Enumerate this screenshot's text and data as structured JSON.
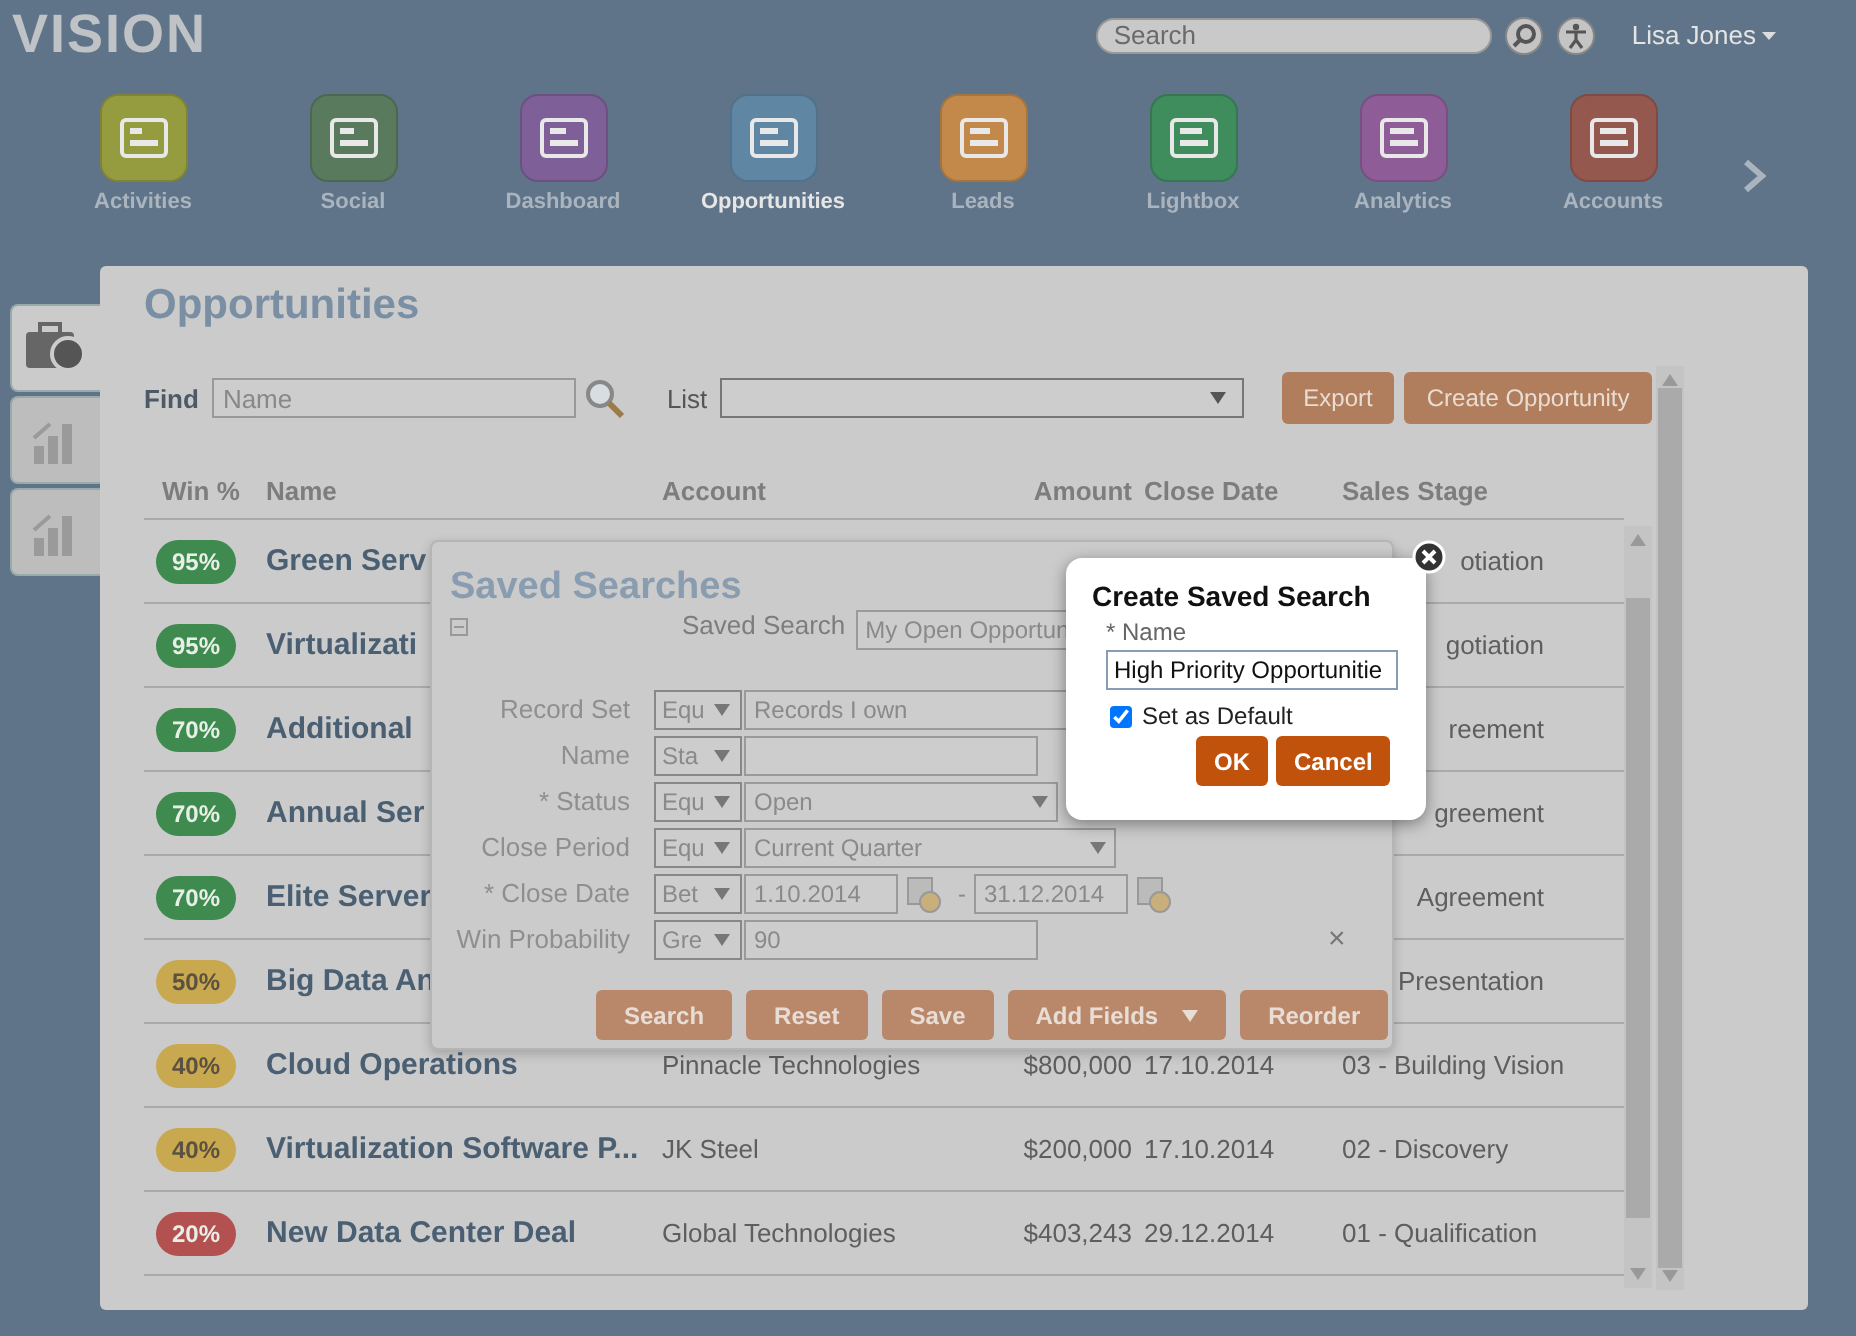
{
  "header": {
    "logo": "VISION",
    "search": {
      "placeholder": "Search"
    },
    "user": "Lisa Jones"
  },
  "nav": [
    {
      "label": "Activities",
      "color": "#959b3f",
      "selected": false
    },
    {
      "label": "Social",
      "color": "#5a7a5e",
      "selected": false
    },
    {
      "label": "Dashboard",
      "color": "#7e5f98",
      "selected": false
    },
    {
      "label": "Opportunities",
      "color": "#5f86a3",
      "selected": true
    },
    {
      "label": "Leads",
      "color": "#c2894a",
      "selected": false
    },
    {
      "label": "Lightbox",
      "color": "#3f8c5c",
      "selected": false
    },
    {
      "label": "Analytics",
      "color": "#8e5d97",
      "selected": false
    },
    {
      "label": "Accounts",
      "color": "#95584f",
      "selected": false
    }
  ],
  "side_tabs": [
    {
      "selected": true
    },
    {
      "selected": false
    },
    {
      "selected": false
    }
  ],
  "page": {
    "title": "Opportunities",
    "find_label": "Find",
    "find_placeholder": "Name",
    "list_label": "List",
    "buttons": [
      "Export",
      "Create Opportunity"
    ]
  },
  "table": {
    "columns": [
      "Win %",
      "Name",
      "Account",
      "Amount",
      "Close Date",
      "Sales Stage"
    ],
    "rows": [
      {
        "win": "95%",
        "color": "#3f8a4e",
        "name": "Green Serv",
        "stage": "otiation"
      },
      {
        "win": "95%",
        "color": "#3f8a4e",
        "name": "Virtualizati",
        "stage": "gotiation"
      },
      {
        "win": "70%",
        "color": "#3f8a4e",
        "name": "Additional",
        "stage": "reement"
      },
      {
        "win": "70%",
        "color": "#3f8a4e",
        "name": "Annual Ser",
        "stage": "greement"
      },
      {
        "win": "70%",
        "color": "#3f8a4e",
        "name": "Elite Server",
        "stage": "Agreement"
      },
      {
        "win": "50%",
        "color": "#c9a94f",
        "name": "Big Data An",
        "stage": "Presentation"
      },
      {
        "win": "40%",
        "color": "#c9a94f",
        "name": "Cloud Operations",
        "account": "Pinnacle Technologies",
        "amount": "$800,000",
        "date": "17.10.2014",
        "stage": "03 - Building Vision"
      },
      {
        "win": "40%",
        "color": "#c9a94f",
        "name": "Virtualization Software P...",
        "account": "JK Steel",
        "amount": "$200,000",
        "date": "17.10.2014",
        "stage": "02 - Discovery"
      },
      {
        "win": "20%",
        "color": "#b2514f",
        "name": "New Data Center Deal",
        "account": "Global Technologies",
        "amount": "$403,243",
        "date": "29.12.2014",
        "stage": "01 - Qualification"
      }
    ]
  },
  "saved_searches": {
    "title": "Saved Searches",
    "saved_search_label": "Saved Search",
    "saved_search_value": "My Open Opportun",
    "fields": [
      {
        "kind": "text",
        "label": "Record Set",
        "operator": "Equ",
        "value": "Records I own"
      },
      {
        "kind": "text",
        "label": "Name",
        "operator": "Sta"
      },
      {
        "kind": "select",
        "label": "* Status",
        "operator": "Equ",
        "value": "Open"
      },
      {
        "kind": "select",
        "label": "Close Period",
        "operator": "Equ",
        "value": "Current Quarter"
      },
      {
        "kind": "range",
        "label": "* Close Date",
        "operator": "Bet",
        "value": "1.10.2014",
        "separator": "-",
        "value_to": "31.12.2014"
      },
      {
        "kind": "text",
        "label": "Win Probability",
        "operator": "Gre",
        "value": "90",
        "clear": "×"
      }
    ],
    "buttons": [
      {
        "label": "Search"
      },
      {
        "label": "Reset"
      },
      {
        "label": "Save"
      },
      {
        "label": "Add Fields",
        "menu": true
      },
      {
        "label": "Reorder"
      }
    ]
  },
  "create_dialog": {
    "title": "Create Saved Search",
    "name_label": "* Name",
    "name_value": "High Priority Opportunitie",
    "set_default": {
      "label": "Set as Default",
      "checked": true
    },
    "buttons": [
      "OK",
      "Cancel"
    ]
  }
}
